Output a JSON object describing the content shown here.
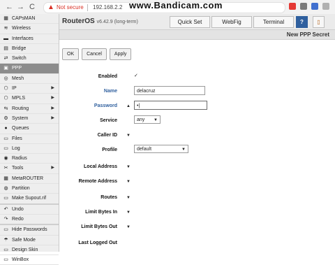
{
  "browser": {
    "back": "←",
    "forward": "→",
    "reload": "C",
    "not_secure": "Not secure",
    "url": "192.168.2.2",
    "watermark": "www.Bandicam.com"
  },
  "sidebar": {
    "items": [
      {
        "label": "CAPsMAN",
        "icon": "▦"
      },
      {
        "label": "Wireless",
        "icon": "≋"
      },
      {
        "label": "Interfaces",
        "icon": "▬"
      },
      {
        "label": "Bridge",
        "icon": "▤"
      },
      {
        "label": "Switch",
        "icon": "⇄"
      },
      {
        "label": "PPP",
        "icon": "▣"
      },
      {
        "label": "Mesh",
        "icon": "◎"
      },
      {
        "label": "IP",
        "icon": "⬡"
      },
      {
        "label": "MPLS",
        "icon": "⬡"
      },
      {
        "label": "Routing",
        "icon": "⇆"
      },
      {
        "label": "System",
        "icon": "⚙"
      },
      {
        "label": "Queues",
        "icon": "●"
      },
      {
        "label": "Files",
        "icon": "▭"
      },
      {
        "label": "Log",
        "icon": "▭"
      },
      {
        "label": "Radius",
        "icon": "◉"
      },
      {
        "label": "Tools",
        "icon": "✂"
      },
      {
        "label": "MetaROUTER",
        "icon": "▦"
      },
      {
        "label": "Partition",
        "icon": "◍"
      },
      {
        "label": "Make Supout.rif",
        "icon": "▭"
      },
      {
        "label": "Undo",
        "icon": "↶"
      },
      {
        "label": "Redo",
        "icon": "↷"
      },
      {
        "label": "Hide Passwords",
        "icon": "▭"
      },
      {
        "label": "Safe Mode",
        "icon": "☂"
      },
      {
        "label": "Design Skin",
        "icon": "▭"
      },
      {
        "label": "WinBox",
        "icon": "▭"
      }
    ]
  },
  "header": {
    "brand": "RouterOS",
    "version": "v6.42.9 (long-term)",
    "quick_set": "Quick Set",
    "webfig": "WebFig",
    "terminal": "Terminal",
    "help": "?",
    "logout": "▯"
  },
  "window": {
    "title": "New PPP Secret"
  },
  "actions": {
    "ok": "OK",
    "cancel": "Cancel",
    "apply": "Apply"
  },
  "form": {
    "enabled_label": "Enabled",
    "enabled_mark": "✓",
    "name_label": "Name",
    "name_value": "delacruz",
    "password_label": "Password",
    "password_value": "•|",
    "service_label": "Service",
    "service_value": "any",
    "caller_id_label": "Caller ID",
    "profile_label": "Profile",
    "profile_value": "default",
    "local_address_label": "Local Address",
    "remote_address_label": "Remote Address",
    "routes_label": "Routes",
    "limit_in_label": "Limit Bytes In",
    "limit_out_label": "Limit Bytes Out",
    "last_logged_out_label": "Last Logged Out"
  },
  "icons": {
    "caret_down": "▼",
    "caret_up": "▲",
    "arrow_right": "▶"
  }
}
